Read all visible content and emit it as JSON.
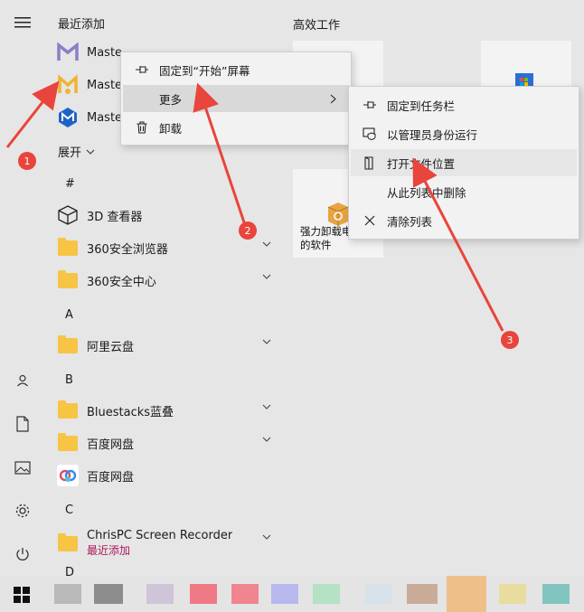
{
  "start": {
    "recent_title": "最近添加",
    "expand_label": "展开",
    "productivity_title": "高效工作",
    "recent_apps": [
      {
        "label": "Maste"
      },
      {
        "label": "Maste"
      },
      {
        "label": "Maste"
      }
    ],
    "letters": {
      "hash": "#",
      "a": "A",
      "b": "B",
      "c": "C",
      "d": "D"
    },
    "apps": {
      "viewer3d": "3D 查看器",
      "browser360": "360安全浏览器",
      "security360": "360安全中心",
      "aliyun": "阿里云盘",
      "bluestacks": "Bluestacks蓝叠",
      "baidu_folder": "百度网盘",
      "baidu_app": "百度网盘",
      "chrispc": "ChrisPC Screen Recorder",
      "chrispc_sub": "最近添加"
    },
    "tile_uninstall_label": "强力卸载电脑中的软件",
    "tile_uninstall_line1": "强力卸载电",
    "tile_uninstall_line2": "的软件"
  },
  "context_menu": {
    "pin_start": "固定到“开始”屏幕",
    "more": "更多",
    "uninstall": "卸载"
  },
  "submenu": {
    "pin_taskbar": "固定到任务栏",
    "run_admin": "以管理员身份运行",
    "open_location": "打开文件位置",
    "remove_list": "从此列表中删除",
    "clear_list": "清除列表"
  },
  "annotations": {
    "one": "1",
    "two": "2",
    "three": "3"
  },
  "colors": {
    "annotation_red": "#e8453c",
    "folder_yellow": "#f7c443",
    "accent_sub": "#b0165d"
  }
}
